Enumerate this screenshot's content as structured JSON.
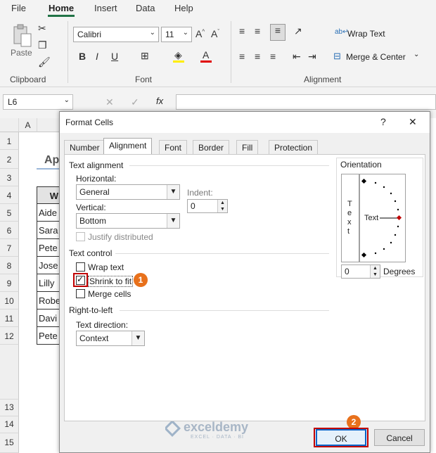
{
  "menu": {
    "file": "File",
    "home": "Home",
    "insert": "Insert",
    "data": "Data",
    "help": "Help"
  },
  "ribbon": {
    "clipboard_label": "Clipboard",
    "paste": "Paste",
    "font_label": "Font",
    "font_name": "Calibri",
    "font_size": "11",
    "alignment_label": "Alignment",
    "wrap_text": "Wrap Text",
    "merge_center": "Merge & Center"
  },
  "formula": {
    "namebox": "L6",
    "fx": "fx"
  },
  "sheet": {
    "col_a": "A",
    "row_numbers": [
      "1",
      "2",
      "3",
      "4",
      "5",
      "6",
      "7",
      "8",
      "9",
      "10",
      "11",
      "12",
      "13",
      "14",
      "15"
    ],
    "title_partial": "Ap",
    "header_cell": "W",
    "cells": [
      "Aide",
      "Sara",
      "Pete",
      "Jose",
      "Lilly",
      "Robe",
      "Davi",
      "Pete"
    ]
  },
  "dialog": {
    "title": "Format Cells",
    "help": "?",
    "close": "✕",
    "tabs": [
      "Number",
      "Alignment",
      "Font",
      "Border",
      "Fill",
      "Protection"
    ],
    "text_alignment": "Text alignment",
    "horizontal_label": "Horizontal:",
    "horizontal_value": "General",
    "vertical_label": "Vertical:",
    "vertical_value": "Bottom",
    "indent_label": "Indent:",
    "indent_value": "0",
    "justify_distributed": "Justify distributed",
    "text_control": "Text control",
    "wrap_text": "Wrap text",
    "shrink_to_fit": "Shrink to fit",
    "merge_cells": "Merge cells",
    "right_to_left": "Right-to-left",
    "text_direction_label": "Text direction:",
    "text_direction_value": "Context",
    "orientation": "Orientation",
    "vertical_text": [
      "T",
      "e",
      "x",
      "t"
    ],
    "orientation_text": "Text",
    "degrees_value": "0",
    "degrees_label": "Degrees",
    "ok": "OK",
    "cancel": "Cancel",
    "badge1": "1",
    "badge2": "2"
  },
  "watermark": {
    "name": "exceldemy",
    "tagline": "EXCEL · DATA · BI"
  },
  "colors": {
    "accent": "#217346",
    "highlight": "#c00000",
    "badge": "#e8711c",
    "ok_border": "#0a64c8"
  }
}
